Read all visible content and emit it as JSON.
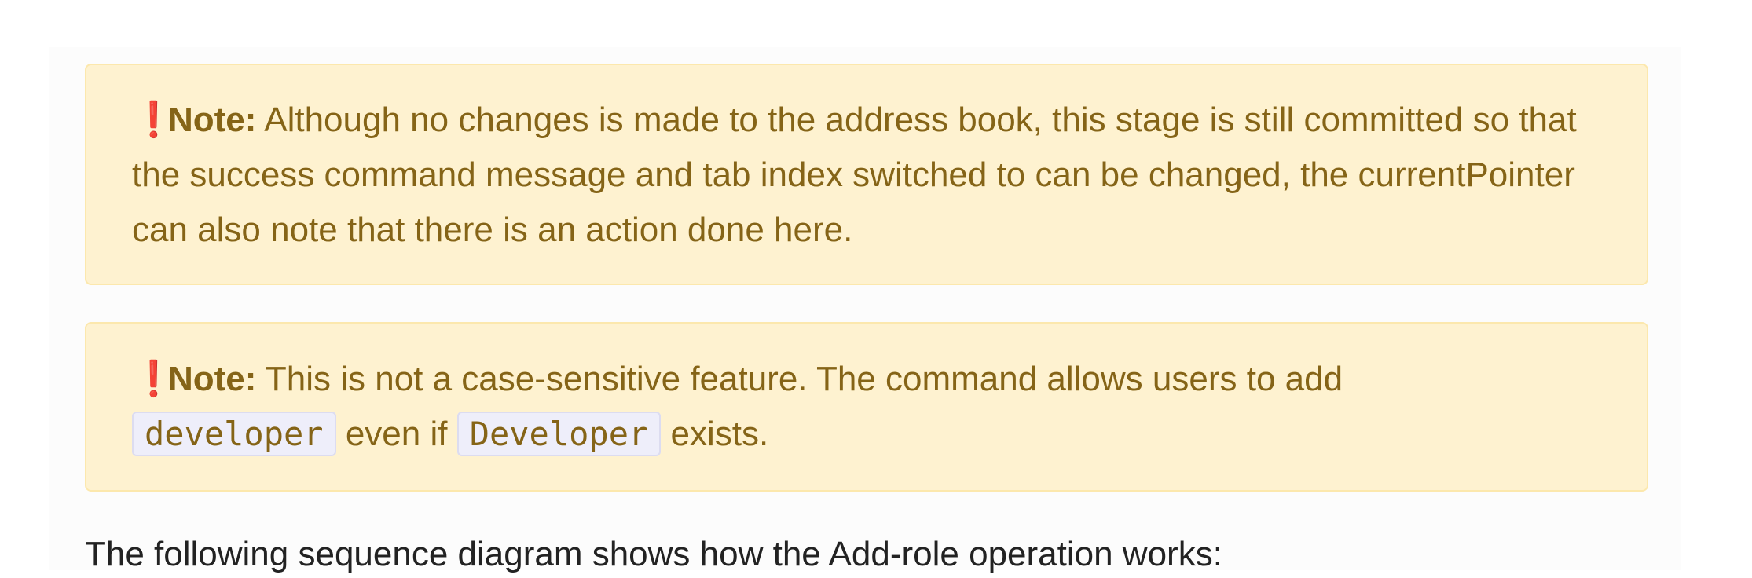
{
  "notes": [
    {
      "icon": "exclamation-icon",
      "icon_glyph": "❗",
      "label": "Note:",
      "text": "Although no changes is made to the address book, this stage is still committed so that the success command message and tab index switched to can be changed, the currentPointer can also note that there is an action done here."
    },
    {
      "icon": "exclamation-icon",
      "icon_glyph": "❗",
      "label": "Note:",
      "text_before": "This is not a case-sensitive feature. The command allows users to add",
      "code1": "developer",
      "text_middle": "even if",
      "code2": "Developer",
      "text_after": "exists."
    }
  ],
  "paragraph": "The following sequence diagram shows how the Add-role operation works:",
  "colors": {
    "note_bg": "#fef2d0",
    "note_border": "#fce8ad",
    "note_text": "#856417",
    "icon": "#dc2832"
  }
}
